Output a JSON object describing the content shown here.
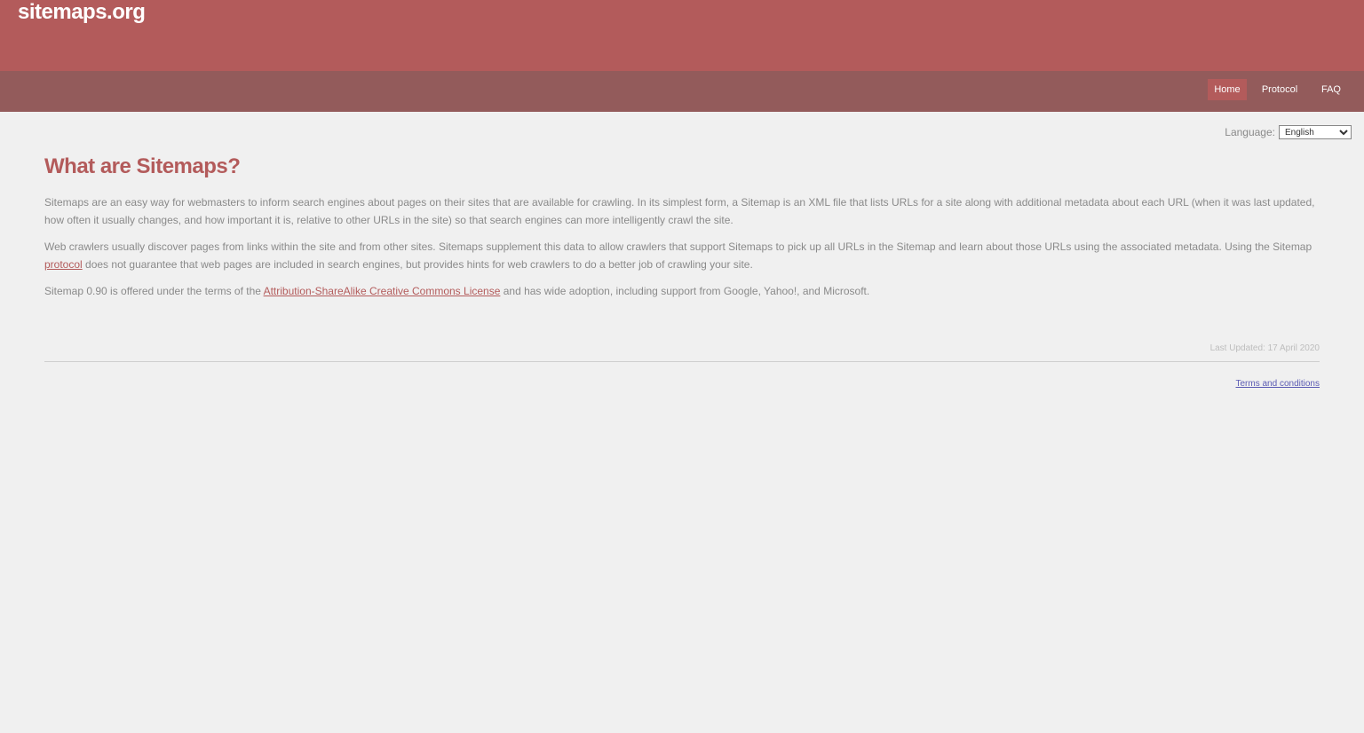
{
  "header": {
    "site_title": "sitemaps.org",
    "bg_color": "#b35b5b"
  },
  "nav": {
    "items": [
      {
        "label": "Home",
        "active": true
      },
      {
        "label": "Protocol",
        "active": false
      },
      {
        "label": "FAQ",
        "active": false
      }
    ],
    "bg_color": "#935b5b"
  },
  "language": {
    "label": "Language:",
    "selected": "English"
  },
  "main": {
    "title": "What are Sitemaps?",
    "p1": "Sitemaps are an easy way for webmasters to inform search engines about pages on their sites that are available for crawling. In its simplest form, a Sitemap is an XML file that lists URLs for a site along with additional metadata about each URL (when it was last updated, how often it usually changes, and how important it is, relative to other URLs in the site) so that search engines can more intelligently crawl the site.",
    "p2_before": "Web crawlers usually discover pages from links within the site and from other sites. Sitemaps supplement this data to allow crawlers that support Sitemaps to pick up all URLs in the Sitemap and learn about those URLs using the associated metadata. Using the Sitemap ",
    "p2_link": "protocol",
    "p2_after": " does not guarantee that web pages are included in search engines, but provides hints for web crawlers to do a better job of crawling your site.",
    "p3_before": "Sitemap 0.90 is offered under the terms of the ",
    "p3_link": "Attribution-ShareAlike Creative Commons License",
    "p3_after": " and has wide adoption, including support from Google, Yahoo!, and Microsoft."
  },
  "footer": {
    "last_updated": "Last Updated: 17 April 2020",
    "terms": "Terms and conditions"
  }
}
